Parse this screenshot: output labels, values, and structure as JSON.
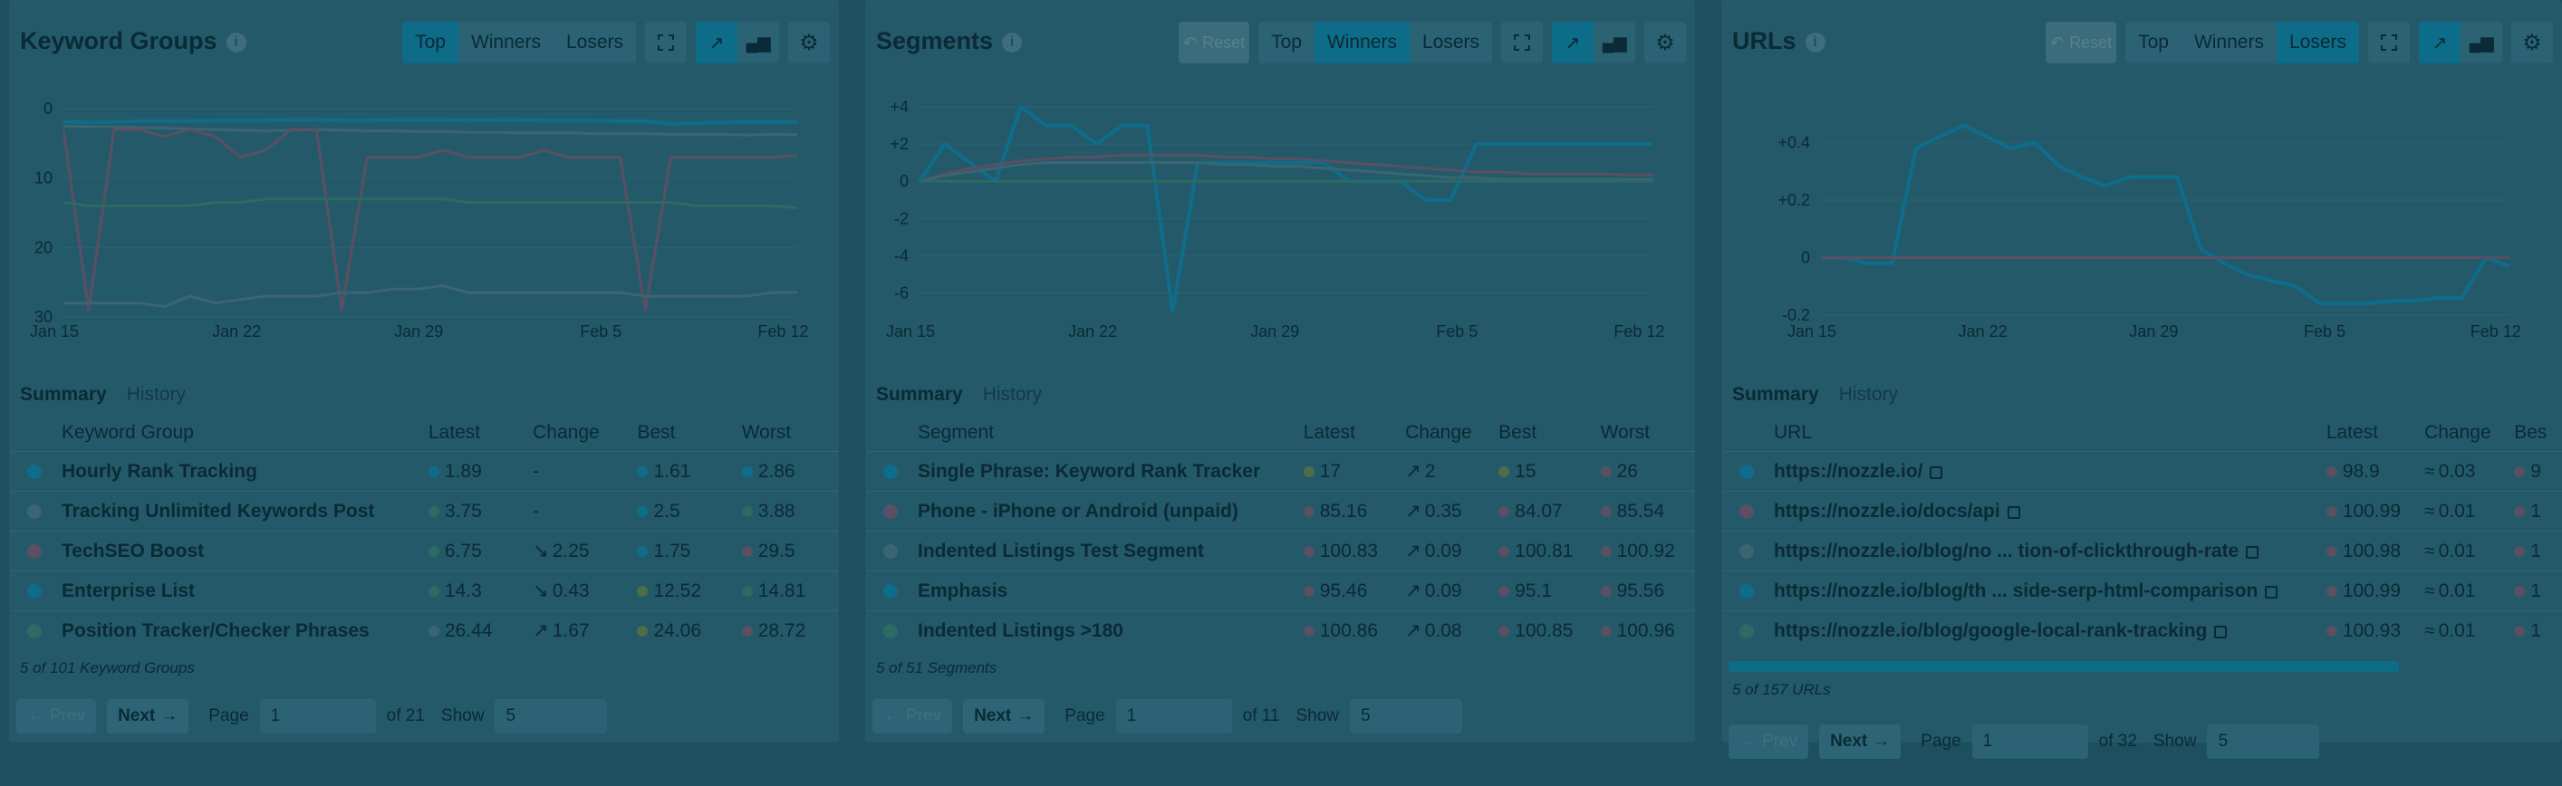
{
  "colors": {
    "teal": "#0e6d8a",
    "grey": "#3b6572",
    "mauve": "#5a4f63",
    "green": "#2d6a63",
    "olive": "#4f6e47"
  },
  "panels": [
    {
      "title": "Keyword Groups",
      "toggle": [
        "Top",
        "Winners",
        "Losers"
      ],
      "active_toggle": "Top",
      "reset_label": "",
      "tabs": [
        "Summary",
        "History"
      ],
      "columns": [
        "Keyword Group",
        "Latest",
        "Change",
        "Best",
        "Worst"
      ],
      "rows": [
        {
          "name": "Hourly Rank Tracking",
          "color": "#0e6d8a",
          "latest": "1.89",
          "lc": "#0e6d8a",
          "change": "-",
          "dir": "",
          "best": "1.61",
          "bc": "#0e6d8a",
          "worst": "2.86",
          "wc": "#0e6d8a"
        },
        {
          "name": "Tracking Unlimited Keywords Post",
          "color": "#3b6572",
          "latest": "3.75",
          "lc": "#2d6a63",
          "change": "-",
          "dir": "",
          "best": "2.5",
          "bc": "#0e6d8a",
          "worst": "3.88",
          "wc": "#2d6a63"
        },
        {
          "name": "TechSEO Boost",
          "color": "#5a4f63",
          "latest": "6.75",
          "lc": "#2d6a63",
          "change": "2.25",
          "dir": "down",
          "best": "1.75",
          "bc": "#0e6d8a",
          "worst": "29.5",
          "wc": "#5a4f63"
        },
        {
          "name": "Enterprise List",
          "color": "#0e6d8a",
          "latest": "14.3",
          "lc": "#2d6a63",
          "change": "0.43",
          "dir": "down",
          "best": "12.52",
          "bc": "#4f6e47",
          "worst": "14.81",
          "wc": "#2d6a63"
        },
        {
          "name": "Position Tracker/Checker Phrases",
          "color": "#2d6a63",
          "latest": "26.44",
          "lc": "#3b6572",
          "change": "1.67",
          "dir": "up",
          "best": "24.06",
          "bc": "#4f6e47",
          "worst": "28.72",
          "wc": "#5a4f63"
        }
      ],
      "footer": "5 of 101 Keyword Groups",
      "pager": {
        "prev": "Prev",
        "next": "Next",
        "page_label": "Page",
        "page": "1",
        "of": "of 21",
        "show_label": "Show",
        "show": "5"
      }
    },
    {
      "title": "Segments",
      "toggle": [
        "Top",
        "Winners",
        "Losers"
      ],
      "active_toggle": "Winners",
      "reset_label": "Reset",
      "tabs": [
        "Summary",
        "History"
      ],
      "columns": [
        "Segment",
        "Latest",
        "Change",
        "Best",
        "Worst"
      ],
      "rows": [
        {
          "name": "Single Phrase: Keyword Rank Tracker",
          "color": "#0e6d8a",
          "latest": "17",
          "lc": "#4f6e47",
          "change": "2",
          "dir": "up",
          "best": "15",
          "bc": "#4f6e47",
          "worst": "26",
          "wc": "#5a4f63"
        },
        {
          "name": "Phone - iPhone or Android (unpaid)",
          "color": "#5a4f63",
          "latest": "85.16",
          "lc": "#5a4f63",
          "change": "0.35",
          "dir": "up",
          "best": "84.07",
          "bc": "#5a4f63",
          "worst": "85.54",
          "wc": "#5a4f63"
        },
        {
          "name": "Indented Listings Test Segment",
          "color": "#3b6572",
          "latest": "100.83",
          "lc": "#5a4f63",
          "change": "0.09",
          "dir": "up",
          "best": "100.81",
          "bc": "#5a4f63",
          "worst": "100.92",
          "wc": "#5a4f63"
        },
        {
          "name": "Emphasis",
          "color": "#0e6d8a",
          "latest": "95.46",
          "lc": "#5a4f63",
          "change": "0.09",
          "dir": "up",
          "best": "95.1",
          "bc": "#5a4f63",
          "worst": "95.56",
          "wc": "#5a4f63"
        },
        {
          "name": "Indented Listings >180",
          "color": "#2d6a63",
          "latest": "100.86",
          "lc": "#5a4f63",
          "change": "0.08",
          "dir": "up",
          "best": "100.85",
          "bc": "#5a4f63",
          "worst": "100.96",
          "wc": "#5a4f63"
        }
      ],
      "footer": "5 of 51 Segments",
      "pager": {
        "prev": "Prev",
        "next": "Next",
        "page_label": "Page",
        "page": "1",
        "of": "of 11",
        "show_label": "Show",
        "show": "5"
      }
    },
    {
      "title": "URLs",
      "toggle": [
        "Top",
        "Winners",
        "Losers"
      ],
      "active_toggle": "Losers",
      "reset_label": "Reset",
      "tabs": [
        "Summary",
        "History"
      ],
      "columns": [
        "URL",
        "Latest",
        "Change",
        "Bes"
      ],
      "rows": [
        {
          "name": "https://nozzle.io/",
          "color": "#0e6d8a",
          "latest": "98.9",
          "lc": "#5a4f63",
          "change": "0.03",
          "dir": "flat",
          "best": "9",
          "bc": "#5a4f63"
        },
        {
          "name": "https://nozzle.io/docs/api",
          "color": "#5a4f63",
          "latest": "100.99",
          "lc": "#5a4f63",
          "change": "0.01",
          "dir": "flat",
          "best": "1",
          "bc": "#5a4f63"
        },
        {
          "name": "https://nozzle.io/blog/no ... tion-of-clickthrough-rate",
          "color": "#3b6572",
          "latest": "100.98",
          "lc": "#5a4f63",
          "change": "0.01",
          "dir": "flat",
          "best": "1",
          "bc": "#5a4f63"
        },
        {
          "name": "https://nozzle.io/blog/th ... side-serp-html-comparison",
          "color": "#0e6d8a",
          "latest": "100.99",
          "lc": "#5a4f63",
          "change": "0.01",
          "dir": "flat",
          "best": "1",
          "bc": "#5a4f63"
        },
        {
          "name": "https://nozzle.io/blog/google-local-rank-tracking",
          "color": "#2d6a63",
          "latest": "100.93",
          "lc": "#5a4f63",
          "change": "0.01",
          "dir": "flat",
          "best": "1",
          "bc": "#5a4f63"
        }
      ],
      "footer": "5 of 157 URLs",
      "pager": {
        "prev": "Prev",
        "next": "Next",
        "page_label": "Page",
        "page": "1",
        "of": "of 32",
        "show_label": "Show",
        "show": "5"
      }
    }
  ],
  "chart_data": [
    {
      "type": "line",
      "x_ticks": [
        "Jan 15",
        "Jan 22",
        "Jan 29",
        "Feb 5",
        "Feb 12"
      ],
      "y_ticks": [
        "0",
        "10",
        "20",
        "30"
      ],
      "ylim": [
        30,
        0
      ],
      "n_points": 30,
      "series": [
        {
          "color": "#0e6d8a",
          "values": [
            1.9,
            2.0,
            1.9,
            1.8,
            1.8,
            1.8,
            1.7,
            1.7,
            1.7,
            1.6,
            1.6,
            1.7,
            1.7,
            1.6,
            1.6,
            1.6,
            1.7,
            1.6,
            1.6,
            1.7,
            1.7,
            1.7,
            1.8,
            1.8,
            2.2,
            2.1,
            2.0,
            1.9,
            1.9,
            1.89
          ]
        },
        {
          "color": "#3b6572",
          "values": [
            2.5,
            2.6,
            2.6,
            2.7,
            2.8,
            2.9,
            3.0,
            3.1,
            3.2,
            3.1,
            3.0,
            3.1,
            3.2,
            3.2,
            3.3,
            3.3,
            3.4,
            3.4,
            3.5,
            3.5,
            3.5,
            3.6,
            3.6,
            3.6,
            3.7,
            3.7,
            3.7,
            3.8,
            3.7,
            3.75
          ]
        },
        {
          "color": "#5a4f63",
          "values": [
            3,
            29,
            3,
            3,
            4,
            3,
            4,
            7,
            6,
            3,
            3,
            29,
            7,
            7,
            7,
            6,
            7,
            7,
            7,
            6,
            7,
            7,
            7,
            29,
            7,
            7,
            7,
            7,
            7,
            6.75
          ]
        },
        {
          "color": "#2d6a63",
          "values": [
            13.5,
            14,
            14,
            14,
            14,
            14,
            13.5,
            13.5,
            13,
            13,
            13,
            13,
            13,
            13,
            13,
            13,
            13.5,
            13.5,
            13.5,
            13.5,
            13.5,
            13.5,
            13.5,
            13.5,
            13.5,
            14,
            14,
            14,
            14,
            14.3
          ]
        },
        {
          "color": "#3b6572",
          "values": [
            28,
            28,
            28,
            28,
            28.5,
            27,
            28,
            27.5,
            27,
            27,
            27,
            26.5,
            26.5,
            26,
            26,
            25.5,
            26.5,
            26.5,
            26.5,
            26.5,
            26.5,
            26.5,
            26.5,
            27,
            27,
            27,
            27,
            27,
            26.5,
            26.44
          ]
        }
      ]
    },
    {
      "type": "line",
      "x_ticks": [
        "Jan 15",
        "Jan 22",
        "Jan 29",
        "Feb 5",
        "Feb 12"
      ],
      "y_ticks": [
        "+4",
        "+2",
        "0",
        "-2",
        "-4",
        "-6"
      ],
      "ylim": [
        -7,
        4
      ],
      "n_points": 30,
      "series": [
        {
          "color": "#0e6d8a",
          "values": [
            0,
            2,
            1,
            0,
            4,
            3,
            3,
            2,
            3,
            3,
            -7,
            1,
            1,
            1,
            1,
            1,
            1,
            0,
            0,
            0,
            -1,
            -1,
            2,
            2,
            2,
            2,
            2,
            2,
            2,
            2
          ]
        },
        {
          "color": "#5a4f63",
          "values": [
            0,
            0.4,
            0.7,
            0.9,
            1.1,
            1.2,
            1.3,
            1.3,
            1.4,
            1.4,
            1.4,
            1.4,
            1.3,
            1.3,
            1.2,
            1.2,
            1.1,
            1.0,
            0.9,
            0.8,
            0.7,
            0.6,
            0.5,
            0.5,
            0.4,
            0.4,
            0.4,
            0.4,
            0.35,
            0.35
          ]
        },
        {
          "color": "#3b6572",
          "values": [
            0,
            0.3,
            0.5,
            0.7,
            0.9,
            1.0,
            1.0,
            1.0,
            1.0,
            1.0,
            1.0,
            1.0,
            0.9,
            0.9,
            0.8,
            0.8,
            0.7,
            0.6,
            0.5,
            0.4,
            0.3,
            0.2,
            0.2,
            0.1,
            0.1,
            0.1,
            0.1,
            0.1,
            0.1,
            0.1
          ]
        },
        {
          "color": "#2d6a63",
          "values": [
            0,
            0,
            0,
            0,
            0,
            0,
            0,
            0,
            0,
            0,
            0,
            0,
            0,
            0,
            0,
            0,
            0,
            0,
            0,
            0,
            0,
            0,
            0,
            0,
            0,
            0,
            0,
            0,
            0,
            0
          ]
        }
      ]
    },
    {
      "type": "line",
      "x_ticks": [
        "Jan 15",
        "Jan 22",
        "Jan 29",
        "Feb 5",
        "Feb 12"
      ],
      "y_ticks": [
        "+0.4",
        "+0.2",
        "0",
        "-0.2"
      ],
      "ylim": [
        -0.2,
        0.48
      ],
      "n_points": 30,
      "series": [
        {
          "color": "#0e6d8a",
          "values": [
            0,
            0,
            -0.02,
            -0.02,
            0.38,
            0.42,
            0.46,
            0.42,
            0.38,
            0.4,
            0.32,
            0.28,
            0.25,
            0.28,
            0.28,
            0.28,
            0.03,
            -0.02,
            -0.06,
            -0.08,
            -0.1,
            -0.16,
            -0.16,
            -0.16,
            -0.15,
            -0.15,
            -0.14,
            -0.14,
            0,
            -0.03
          ]
        },
        {
          "color": "#5a4f63",
          "values": [
            0,
            0,
            0,
            0,
            0,
            0,
            0,
            0,
            0,
            0,
            0,
            0,
            0,
            0,
            0,
            0,
            0,
            0,
            0,
            0,
            0,
            0,
            0,
            0,
            0,
            0,
            0,
            0,
            0,
            0
          ]
        }
      ]
    }
  ]
}
